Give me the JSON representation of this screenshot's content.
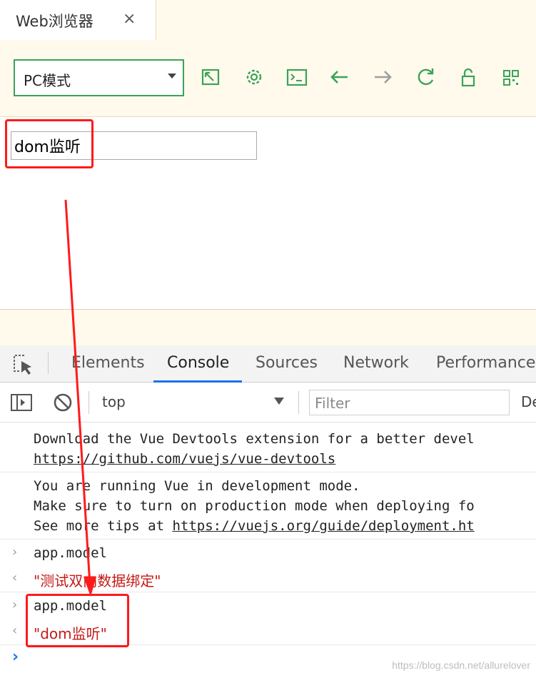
{
  "browser": {
    "tab_title": "Web浏览器",
    "tab_close": "×",
    "mode_select": {
      "selected": "PC模式"
    },
    "toolbar_icons": [
      "screenshot-icon",
      "settings-icon",
      "terminal-icon",
      "back-arrow-icon",
      "forward-arrow-icon",
      "refresh-icon",
      "lock-icon",
      "qr-code-icon"
    ]
  },
  "page": {
    "input_value": "dom监听"
  },
  "devtools": {
    "tabs": [
      "Elements",
      "Console",
      "Sources",
      "Network",
      "Performance"
    ],
    "active_tab": "Console",
    "context": "top",
    "filter_placeholder": "Filter",
    "levels_label": "De"
  },
  "console": {
    "msg1_line1": "Download the Vue Devtools extension for a better devel",
    "msg1_link": "https://github.com/vuejs/vue-devtools",
    "msg2_line1": "You are running Vue in development mode.",
    "msg2_line2": "Make sure to turn on production mode when deploying fo",
    "msg2_line3_prefix": "See more tips at ",
    "msg2_link": "https://vuejs.org/guide/deployment.ht",
    "cmd1": "app.model",
    "res1": "\"测试双向数据绑定\"",
    "cmd2": "app.model",
    "res2_q1": "\"",
    "res2_value": "dom监听",
    "res2_q2": "\"",
    "prompt": "›",
    "input_chevron": "›",
    "output_chevron": "‹"
  },
  "watermark": "https://blog.csdn.net/allurelover",
  "colors": {
    "accent_green": "#3aa35a",
    "toolbar_bg": "#fffaeb",
    "annotation_red": "#ff1a1a",
    "string_red": "#c41a16",
    "active_tab_blue": "#1a73e8"
  }
}
